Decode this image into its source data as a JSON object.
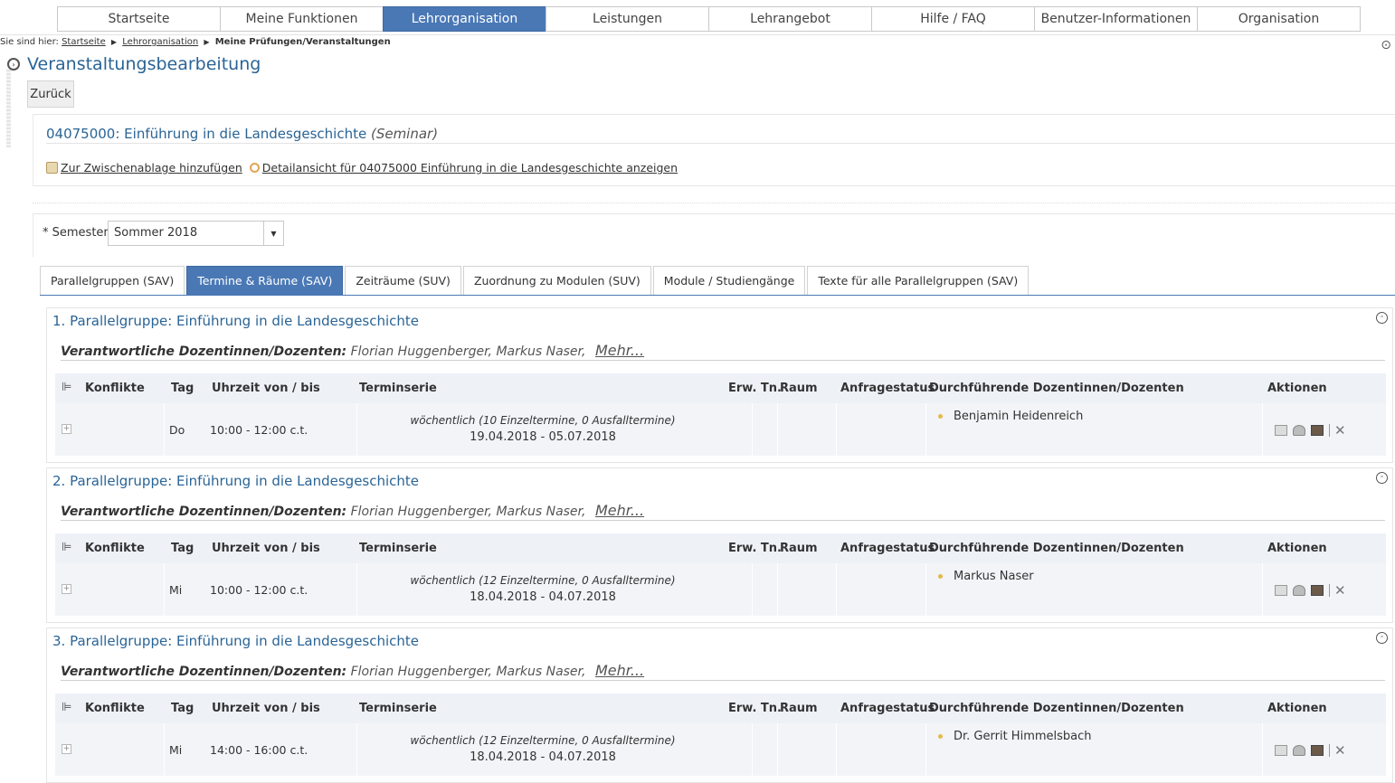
{
  "nav": {
    "items": [
      {
        "label": "Startseite",
        "active": false
      },
      {
        "label": "Meine Funktionen",
        "active": false
      },
      {
        "label": "Lehrorganisation",
        "active": true
      },
      {
        "label": "Leistungen",
        "active": false
      },
      {
        "label": "Lehrangebot",
        "active": false
      },
      {
        "label": "Hilfe / FAQ",
        "active": false
      },
      {
        "label": "Benutzer-Informationen",
        "active": false
      },
      {
        "label": "Organisation",
        "active": false
      }
    ],
    "accent": "#4a78b5"
  },
  "breadcrumb": {
    "prefix": "Sie sind hier:",
    "home": "Startseite",
    "section": "Lehrorganisation",
    "current": "Meine Prüfungen/Veranstaltungen"
  },
  "page": {
    "title": "Veranstaltungsbearbeitung",
    "back_label": "Zurück"
  },
  "course": {
    "title": "04075000: Einführung in die Landesgeschichte",
    "type": "(Seminar)",
    "clipboard_link": "Zur Zwischenablage hinzufügen",
    "detail_link": "Detailansicht für 04075000 Einführung in die Landesgeschichte anzeigen"
  },
  "filter": {
    "semester_label": "* Semester",
    "semester_value": "Sommer 2018"
  },
  "tabs": [
    {
      "label": "Parallelgruppen (SAV)",
      "active": false
    },
    {
      "label": "Termine & Räume (SAV)",
      "active": true
    },
    {
      "label": "Zeiträume (SUV)",
      "active": false
    },
    {
      "label": "Zuordnung zu Modulen (SUV)",
      "active": false
    },
    {
      "label": "Module / Studiengänge",
      "active": false
    },
    {
      "label": "Texte für alle Parallelgruppen (SAV)",
      "active": false
    }
  ],
  "table_headers": {
    "konflikte": "Konflikte",
    "tag": "Tag",
    "uhrzeit": "Uhrzeit von / bis",
    "terminserie": "Terminserie",
    "erw": "Erw. Tn.",
    "raum": "Raum",
    "anfrage": "Anfragestatus",
    "dozenten": "Durchführende Dozentinnen/Dozenten",
    "aktionen": "Aktionen"
  },
  "groups": [
    {
      "title": "1. Parallelgruppe: Einführung in die Landesgeschichte",
      "resp_label": "Verantwortliche Dozentinnen/Dozenten:",
      "resp_names": "Florian Huggenberger, Markus Naser,",
      "more": "Mehr...",
      "row": {
        "tag": "Do",
        "time": "10:00 - 12:00 c.t.",
        "serie": "wöchentlich (10 Einzeltermine, 0 Ausfalltermine)",
        "dates": "19.04.2018 - 05.07.2018",
        "lecturer": "Benjamin Heidenreich"
      }
    },
    {
      "title": "2. Parallelgruppe: Einführung in die Landesgeschichte",
      "resp_label": "Verantwortliche Dozentinnen/Dozenten:",
      "resp_names": "Florian Huggenberger, Markus Naser,",
      "more": "Mehr...",
      "row": {
        "tag": "Mi",
        "time": "10:00 - 12:00 c.t.",
        "serie": "wöchentlich (12 Einzeltermine, 0 Ausfalltermine)",
        "dates": "18.04.2018 - 04.07.2018",
        "lecturer": "Markus Naser"
      }
    },
    {
      "title": "3. Parallelgruppe: Einführung in die Landesgeschichte",
      "resp_label": "Verantwortliche Dozentinnen/Dozenten:",
      "resp_names": "Florian Huggenberger, Markus Naser,",
      "more": "Mehr...",
      "row": {
        "tag": "Mi",
        "time": "14:00 - 16:00 c.t.",
        "serie": "wöchentlich (12 Einzeltermine, 0 Ausfalltermine)",
        "dates": "18.04.2018 - 04.07.2018",
        "lecturer": "Dr. Gerrit Himmelsbach"
      }
    }
  ]
}
